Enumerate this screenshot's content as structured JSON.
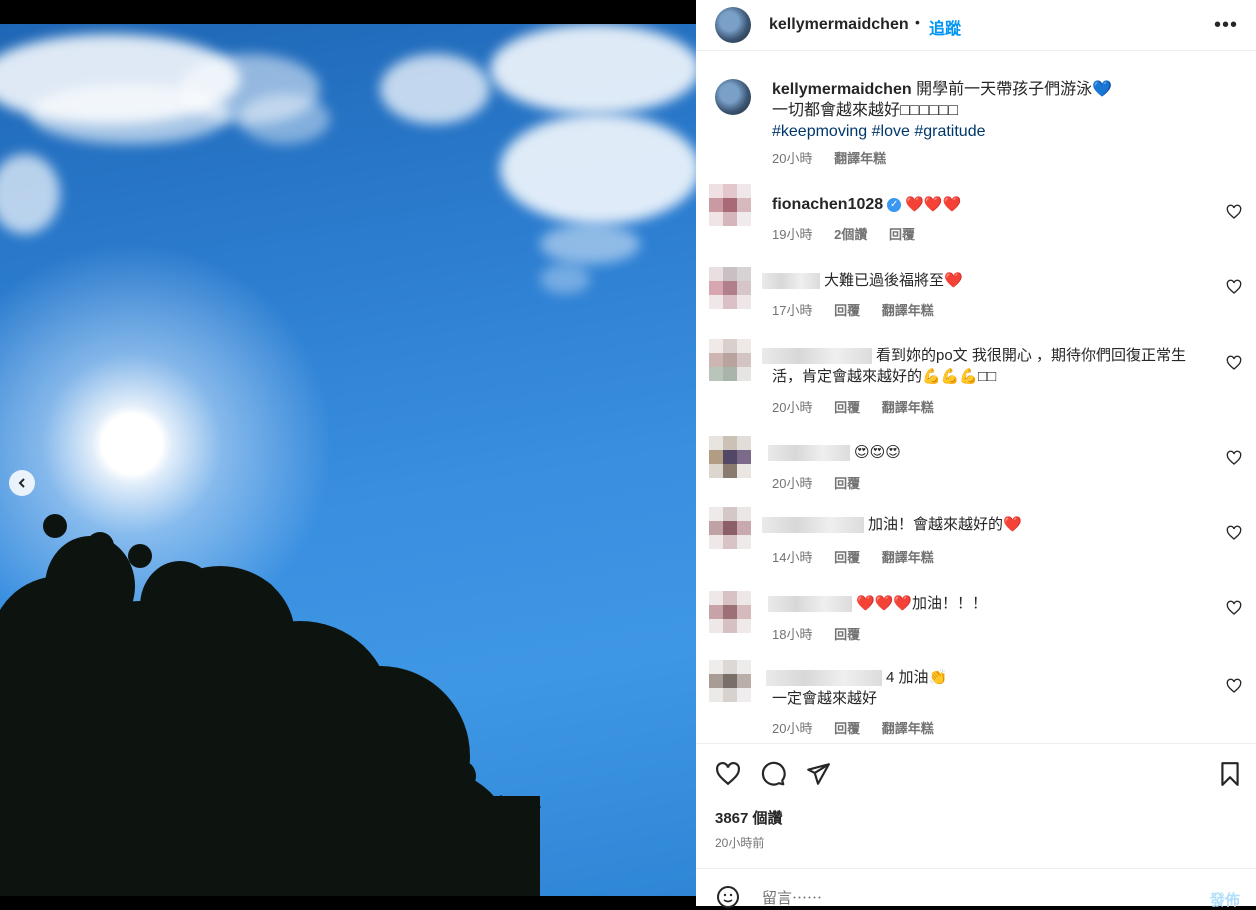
{
  "post": {
    "username": "kellymermaidchen",
    "dot": "•",
    "follow_label": "追蹤",
    "more_label": "•••"
  },
  "caption": {
    "username": "kellymermaidchen",
    "line1": "開學前一天帶孩子們游泳💙",
    "line2": "一切都會越來越好□□□□□□",
    "hashtags": [
      "#keepmoving",
      "#love",
      "#gratitude"
    ],
    "time": "20小時",
    "translate": "翻譯年糕"
  },
  "comments": [
    {
      "username": "fionachen1028",
      "text": "❤️❤️❤️",
      "time": "19小時",
      "likes": "2個讚",
      "reply": "回覆",
      "translate": ""
    },
    {
      "username": "",
      "text": "大難已過後福將至❤️",
      "time": "17小時",
      "likes": "",
      "reply": "回覆",
      "translate": "翻譯年糕"
    },
    {
      "username": "",
      "text": "看到妳的po文 我很開心 ，期待你們回復正常生活，肯定會越來越好的💪💪💪□□",
      "time": "20小時",
      "likes": "",
      "reply": "回覆",
      "translate": "翻譯年糕"
    },
    {
      "username": "",
      "text": "😍😍😍",
      "time": "20小時",
      "likes": "",
      "reply": "回覆",
      "translate": ""
    },
    {
      "username": "",
      "text": "加油！會越來越好的❤️",
      "time": "14小時",
      "likes": "",
      "reply": "回覆",
      "translate": "翻譯年糕"
    },
    {
      "username": "",
      "text": "❤️❤️❤️加油！！！",
      "time": "18小時",
      "likes": "",
      "reply": "回覆",
      "translate": ""
    },
    {
      "username": "",
      "text": "4 加油👏",
      "text2": "一定會越來越好",
      "time": "20小時",
      "likes": "",
      "reply": "回覆",
      "translate": "翻譯年糕"
    }
  ],
  "actions": {
    "likes": "3867 個讚",
    "time": "20小時前"
  },
  "composer": {
    "placeholder": "留言⋯⋯",
    "post_label": "發佈"
  },
  "colors": {
    "accent": "#0095f6",
    "hashtag": "#00376b",
    "heart": "#ed4956"
  }
}
